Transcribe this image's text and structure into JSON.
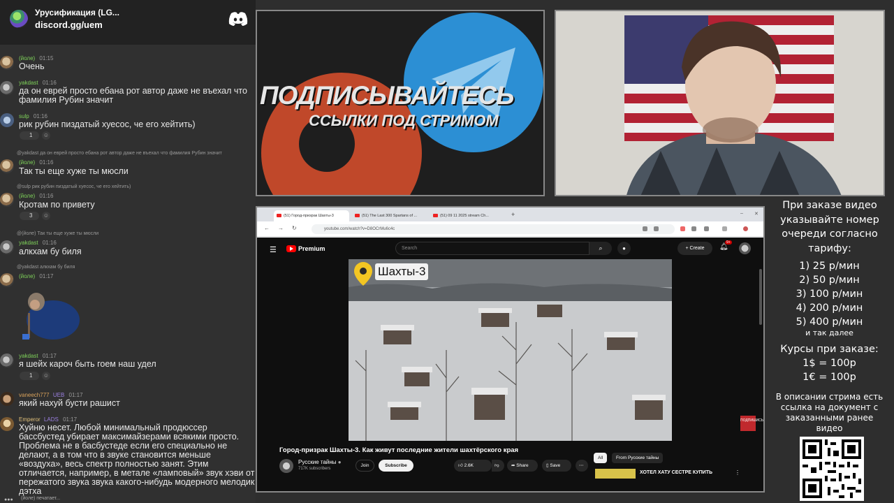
{
  "chat": {
    "server_name": "Урусификация (LG...",
    "server_link": "discord.gg/uem",
    "messages": [
      {
        "user": "(йоле)",
        "time": "01:15",
        "text": "Очень"
      },
      {
        "user": "yakdast",
        "time": "01:16",
        "text": "да он еврей просто ебана рот автор даже не въехал что фамилия Рубин значит"
      },
      {
        "user": "sulp",
        "time": "01:16",
        "text": "рик рубин пиздатый хуесос, че его хейтить)",
        "reaction_count": "1"
      },
      {
        "reply": "@yakdast да он еврей просто ебана рот автор даже не въехал что фамилия Рубин значит",
        "user": "(йоле)",
        "time": "01:16",
        "text": "Так ты еще хуже ты мюсли"
      },
      {
        "reply": "@sulp рик рубин пиздатый хуесос, че его хейтить)",
        "user": "(йоле)",
        "time": "01:16",
        "text": "Кротам по привету",
        "reaction_count": "3"
      },
      {
        "reply": "@(йоле) Так ты еще хуже ты мюсли",
        "user": "yakdast",
        "time": "01:16",
        "text": "алкхам бу биля"
      },
      {
        "reply": "@yakdast алкхам бу биля",
        "user": "(йоле)",
        "time": "01:17",
        "text": ""
      },
      {
        "user": "yakdast",
        "time": "01:17",
        "text": "я шейх кароч быть гоем наш удел",
        "reaction_count": "1"
      },
      {
        "user": "vaneech777",
        "badge": "UEB",
        "time": "01:17",
        "text": "який нахуй бусти рашист"
      },
      {
        "user": "Emperor",
        "badge": "LADS",
        "time": "01:17",
        "text": "Хуйню несет. Любой минимальный продюссер бассбустед убирает максимайзерами всякими просто. Проблема не в басбустеде если его специально не делают, а в том что в звуке становится меньше «воздуха», весь спектр полностью занят. Этим отличается, например, в метале «ламповый» звук хэви от пережатого звука звука какого-нибудь модерного мелодик дэтха"
      }
    ],
    "typing": "(йоле) печатает..."
  },
  "banner": {
    "title": "ПОДПИСЫВАЙТЕСЬ",
    "subtitle": "ССЫЛКИ ПОД СТРИМОМ"
  },
  "browser": {
    "tabs": [
      "(51) Город-призрак Шахты-3",
      "(51) The Last 300 Spartans of ...",
      "(51) 09 11 2025 stream Ch..."
    ],
    "url": "youtube.com/watch?v=D8OCrMu6c4c"
  },
  "youtube": {
    "brand": "Premium",
    "search_placeholder": "Search",
    "create_label": "Create",
    "bell_badge": "9+",
    "location_label": "Шахты-3",
    "video_title": "Город-призрак Шахты-3. Как живут последние жители шахтёрского края",
    "channel_name": "Русские тайны",
    "subscribers": "717K subscribers",
    "join_label": "Join",
    "subscribe_label": "Subscribe",
    "likes": "2.6K",
    "share_label": "Share",
    "save_label": "Save",
    "chip_all": "All",
    "chip_from": "From Русские тайны",
    "rec_title": "ХОТЕЛ ХАТУ СЕСТРЕ КУПИТЬ",
    "side_badge": "ПОДПИШИСЬ"
  },
  "info": {
    "intro": "При заказе видео указывайте номер очереди согласно тарифу:",
    "tariffs": [
      "1) 25 р/мин",
      "2) 50 р/мин",
      "3) 100 р/мин",
      "4) 200 р/мин",
      "5) 400 р/мин"
    ],
    "etc": "и так далее",
    "rates_title": "Курсы при заказе:",
    "rates": [
      "1$ = 100р",
      "1€ = 100р"
    ],
    "doc_note": "В описании стрима есть ссылка на документ с заказанными ранее видео"
  }
}
